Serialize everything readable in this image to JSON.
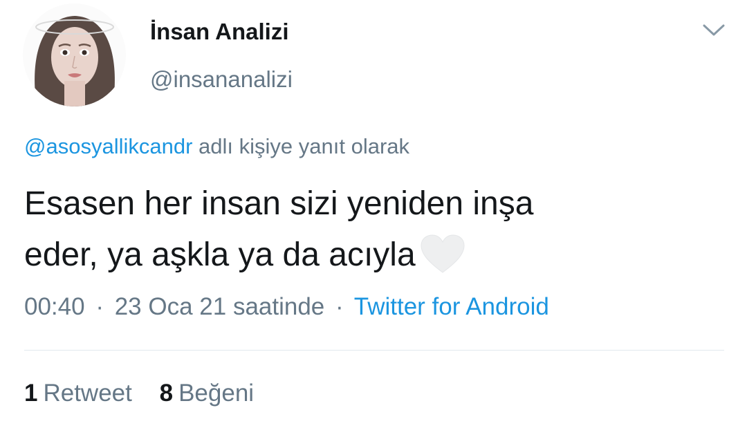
{
  "tweet": {
    "author": {
      "display_name": "İnsan Analizi",
      "handle": "@insananalizi"
    },
    "reply": {
      "mention": "@asosyallikcandr",
      "suffix": "adlı kişiye yanıt olarak"
    },
    "text_line1": "Esasen her insan sizi yeniden inşa",
    "text_line2": "eder, ya aşkla ya da acıyla",
    "emoji": "white-heart",
    "meta": {
      "time": "00:40",
      "separator": "·",
      "date": "23 Oca 21 saatinde",
      "client": "Twitter for Android"
    },
    "stats": {
      "retweets_count": "1",
      "retweets_label": "Retweet",
      "likes_count": "8",
      "likes_label": "Beğeni"
    }
  },
  "icons": {
    "menu": "chevron-down-icon",
    "heart": "white-heart-emoji"
  },
  "colors": {
    "text_primary": "#14171a",
    "text_secondary": "#657786",
    "link": "#1b95e0",
    "divider": "#e1e8ed"
  }
}
